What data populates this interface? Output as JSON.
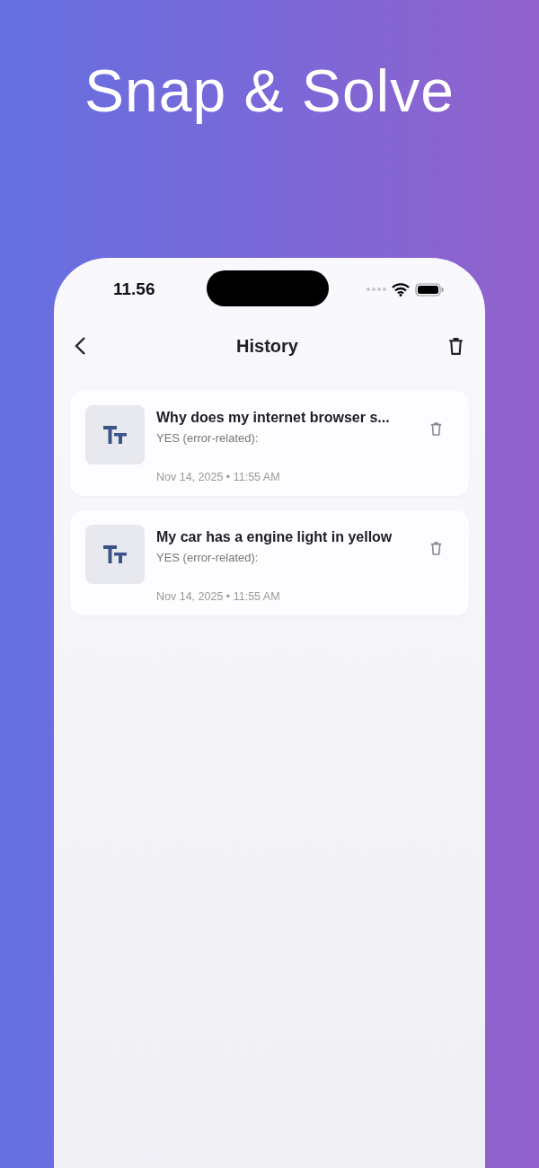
{
  "headline": "Snap & Solve",
  "status_bar": {
    "time": "11.56"
  },
  "nav": {
    "title": "History"
  },
  "history": [
    {
      "title": "Why does my internet browser s...",
      "subtitle": "YES (error-related):",
      "timestamp": "Nov 14, 2025 • 11:55 AM"
    },
    {
      "title": "My car has a engine light in yellow",
      "subtitle": "YES (error-related):",
      "timestamp": "Nov 14, 2025 • 11:55 AM"
    }
  ]
}
